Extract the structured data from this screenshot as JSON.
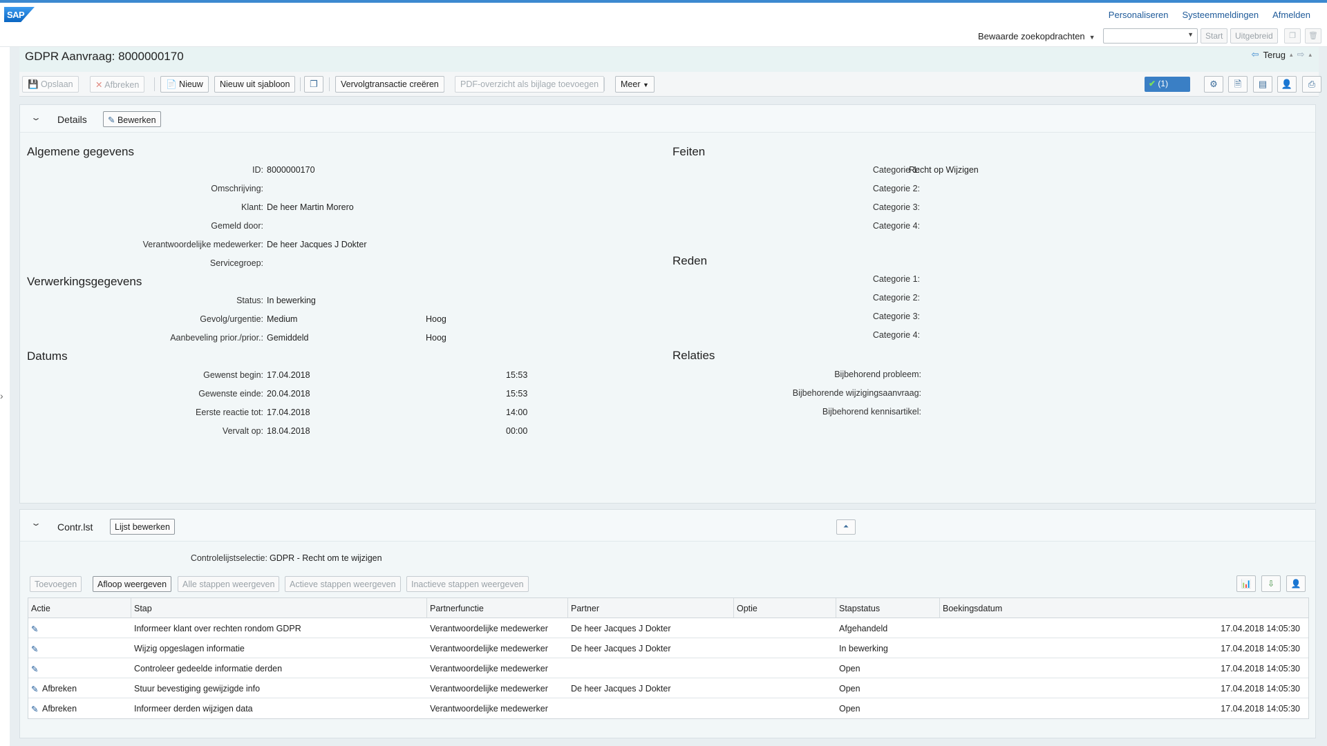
{
  "header": {
    "links": [
      "Personaliseren",
      "Systeemmeldingen",
      "Afmelden"
    ],
    "saved_searches": "Bewaarde zoekopdrachten",
    "start": "Start",
    "extended": "Uitgebreid"
  },
  "page": {
    "title": "GDPR Aanvraag: 8000000170",
    "back": "Terug"
  },
  "toolbar": {
    "save": "Opslaan",
    "cancel": "Afbreken",
    "new": "Nieuw",
    "new_from_template": "Nieuw uit sjabloon",
    "followup": "Vervolgtransactie creëren",
    "pdf": "PDF-overzicht als bijlage toevoegen",
    "more": "Meer",
    "check": "(1)"
  },
  "details": {
    "title": "Details",
    "edit": "Bewerken",
    "general": {
      "heading": "Algemene gegevens",
      "fields": [
        {
          "label": "ID:",
          "value": "8000000170",
          "link": false
        },
        {
          "label": "Omschrijving:",
          "value": "",
          "link": false
        },
        {
          "label": "Klant:",
          "value": "De heer Martin Morero",
          "link": true
        },
        {
          "label": "Gemeld door:",
          "value": "",
          "link": false
        },
        {
          "label": "Verantwoordelijke medewerker:",
          "value": "De heer Jacques J Dokter",
          "link": true
        },
        {
          "label": "Servicegroep:",
          "value": "",
          "link": false
        }
      ]
    },
    "processing": {
      "heading": "Verwerkingsgegevens",
      "fields": [
        {
          "label": "Status:",
          "value": "In bewerking",
          "extra": ""
        },
        {
          "label": "Gevolg/urgentie:",
          "value": "Medium",
          "extra": "Hoog"
        },
        {
          "label": "Aanbeveling prior./prior.:",
          "value": "Gemiddeld",
          "extra": "Hoog"
        }
      ]
    },
    "dates": {
      "heading": "Datums",
      "fields": [
        {
          "label": "Gewenst begin:",
          "value": "17.04.2018",
          "time": "15:53"
        },
        {
          "label": "Gewenste einde:",
          "value": "20.04.2018",
          "time": "15:53"
        },
        {
          "label": "Eerste reactie tot:",
          "value": "17.04.2018",
          "time": "14:00"
        },
        {
          "label": "Vervalt op:",
          "value": "18.04.2018",
          "time": "00:00"
        }
      ]
    },
    "facts": {
      "heading": "Feiten",
      "fields": [
        {
          "label": "Categorie 1:",
          "value": "Recht op Wijzigen"
        },
        {
          "label": "Categorie 2:",
          "value": ""
        },
        {
          "label": "Categorie 3:",
          "value": ""
        },
        {
          "label": "Categorie 4:",
          "value": ""
        }
      ]
    },
    "reason": {
      "heading": "Reden",
      "fields": [
        {
          "label": "Categorie 1:",
          "value": ""
        },
        {
          "label": "Categorie 2:",
          "value": ""
        },
        {
          "label": "Categorie 3:",
          "value": ""
        },
        {
          "label": "Categorie 4:",
          "value": ""
        }
      ]
    },
    "relations": {
      "heading": "Relaties",
      "fields": [
        {
          "label": "Bijbehorend probleem:",
          "value": ""
        },
        {
          "label": "Bijbehorende wijzigingsaanvraag:",
          "value": ""
        },
        {
          "label": "Bijbehorend kennisartikel:",
          "value": ""
        }
      ]
    }
  },
  "checklist": {
    "title": "Contr.lst",
    "edit_list": "Lijst bewerken",
    "selection_label": "Controlelijstselectie:",
    "selection_value": "GDPR - Recht om te wijzigen",
    "buttons": {
      "add": "Toevoegen",
      "show_flow": "Afloop weergeven",
      "all_steps": "Alle stappen weergeven",
      "active_steps": "Actieve stappen weergeven",
      "inactive_steps": "Inactieve stappen weergeven"
    },
    "columns": [
      "Actie",
      "Stap",
      "Partnerfunctie",
      "Partner",
      "Optie",
      "Stapstatus",
      "Boekingsdatum"
    ],
    "rows": [
      {
        "action": "",
        "step": "Informeer klant over rechten rondom GDPR",
        "function": "Verantwoordelijke medewerker",
        "partner": "De heer Jacques J Dokter",
        "option": "",
        "status": "Afgehandeld",
        "date": "17.04.2018 14:05:30"
      },
      {
        "action": "",
        "step": "Wijzig opgeslagen informatie",
        "function": "Verantwoordelijke medewerker",
        "partner": "De heer Jacques J Dokter",
        "option": "",
        "status": "In bewerking",
        "date": "17.04.2018 14:05:30"
      },
      {
        "action": "",
        "step": "Controleer gedeelde informatie derden",
        "function": "Verantwoordelijke medewerker",
        "partner": "",
        "option": "",
        "status": "Open",
        "date": "17.04.2018 14:05:30"
      },
      {
        "action": "Afbreken",
        "step": "Stuur bevestiging gewijzigde info",
        "function": "Verantwoordelijke medewerker",
        "partner": "De heer Jacques J Dokter",
        "option": "",
        "status": "Open",
        "date": "17.04.2018 14:05:30"
      },
      {
        "action": "Afbreken",
        "step": "Informeer derden wijzigen data",
        "function": "Verantwoordelijke medewerker",
        "partner": "",
        "option": "",
        "status": "Open",
        "date": "17.04.2018 14:05:30"
      }
    ]
  }
}
